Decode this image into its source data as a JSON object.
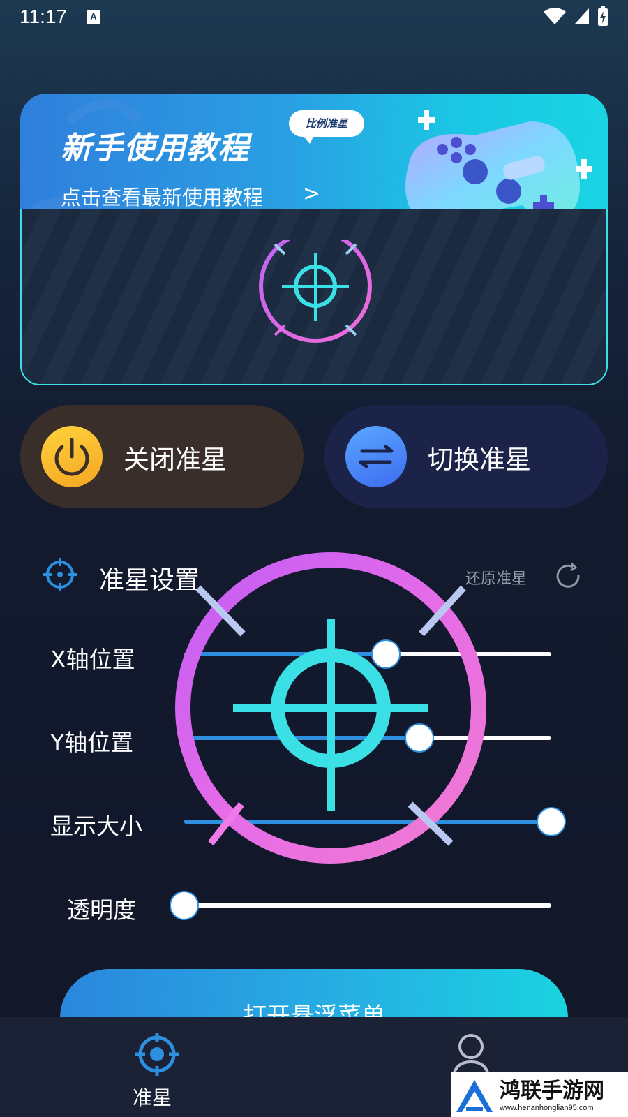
{
  "status_bar": {
    "time": "11:17",
    "a_badge": "A"
  },
  "banner": {
    "title": "新手使用教程",
    "tag": "比例准星",
    "subtitle": "点击查看最新使用教程",
    "arrow": ">"
  },
  "buttons": {
    "close_label": "关闭准星",
    "switch_label": "切换准星"
  },
  "settings": {
    "title": "准星设置",
    "reset_label": "还原准星",
    "sliders": [
      {
        "label": "X轴位置",
        "value": 0.55
      },
      {
        "label": "Y轴位置",
        "value": 0.64
      },
      {
        "label": "显示大小",
        "value": 1.0
      },
      {
        "label": "透明度",
        "value": 0.0
      }
    ]
  },
  "cta": {
    "label": "打开悬浮菜单"
  },
  "bottom_nav": {
    "aim_label": "准星"
  },
  "watermark": {
    "text": "鸿联手游网",
    "url": "www.henanhonglian95.com"
  },
  "colors": {
    "accent_blue": "#2d8fe0",
    "cyan": "#3be0e6",
    "magenta": "#e36cf0"
  }
}
